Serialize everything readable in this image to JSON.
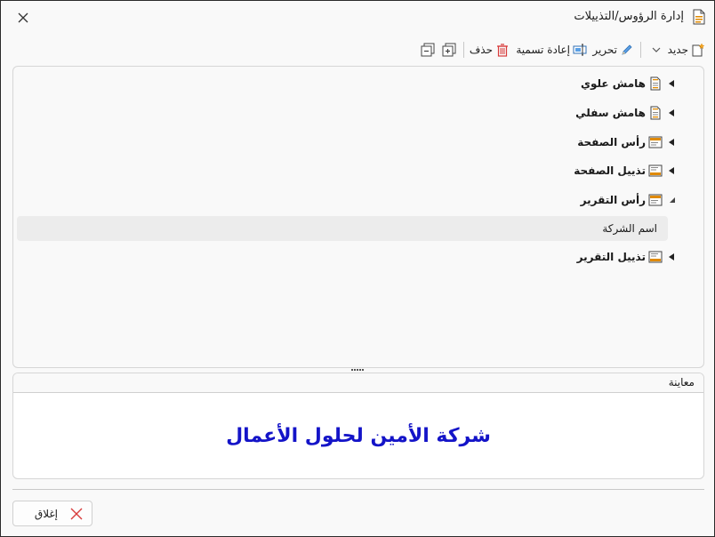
{
  "window": {
    "title": "إدارة الرؤوس/التذييلات"
  },
  "toolbar": {
    "new_label": "جديد",
    "edit_label": "تحرير",
    "rename_label": "إعادة تسمية",
    "delete_label": "حذف"
  },
  "tree": {
    "nodes": [
      {
        "label": "هامش علوي",
        "icon": "page-icon",
        "expanded": false
      },
      {
        "label": "هامش سفلي",
        "icon": "page-icon",
        "expanded": false
      },
      {
        "label": "رأس الصفحة",
        "icon": "header-icon",
        "expanded": false
      },
      {
        "label": "تذييل الصفحة",
        "icon": "footer-icon",
        "expanded": false
      },
      {
        "label": "رأس التقرير",
        "icon": "header-icon",
        "expanded": true,
        "children": [
          {
            "label": "اسم الشركة"
          }
        ]
      },
      {
        "label": "تذييل التقرير",
        "icon": "footer-icon",
        "expanded": false
      }
    ]
  },
  "preview": {
    "header": "معاينة",
    "text": "شركة الأمين لحلول الأعمال",
    "text_color": "#1414c8"
  },
  "footer": {
    "close_label": "إغلاق"
  },
  "colors": {
    "accent_red": "#d83b3b",
    "icon_orange": "#e08a00"
  }
}
